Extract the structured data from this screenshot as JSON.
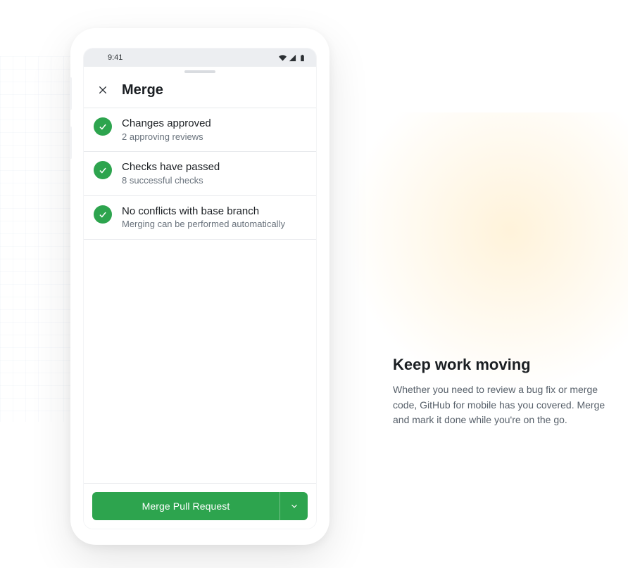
{
  "statusBar": {
    "time": "9:41"
  },
  "sheet": {
    "title": "Merge",
    "items": [
      {
        "title": "Changes approved",
        "subtitle": "2 approving reviews"
      },
      {
        "title": "Checks have passed",
        "subtitle": "8 successful checks"
      },
      {
        "title": "No conflicts with base branch",
        "subtitle": "Merging can be performed automatically"
      }
    ],
    "primaryButton": {
      "label": "Merge Pull Request"
    }
  },
  "marketing": {
    "heading": "Keep work moving",
    "body": "Whether you need to review a bug fix or merge code, GitHub for mobile has you covered. Merge and mark it done while you're on the go."
  }
}
